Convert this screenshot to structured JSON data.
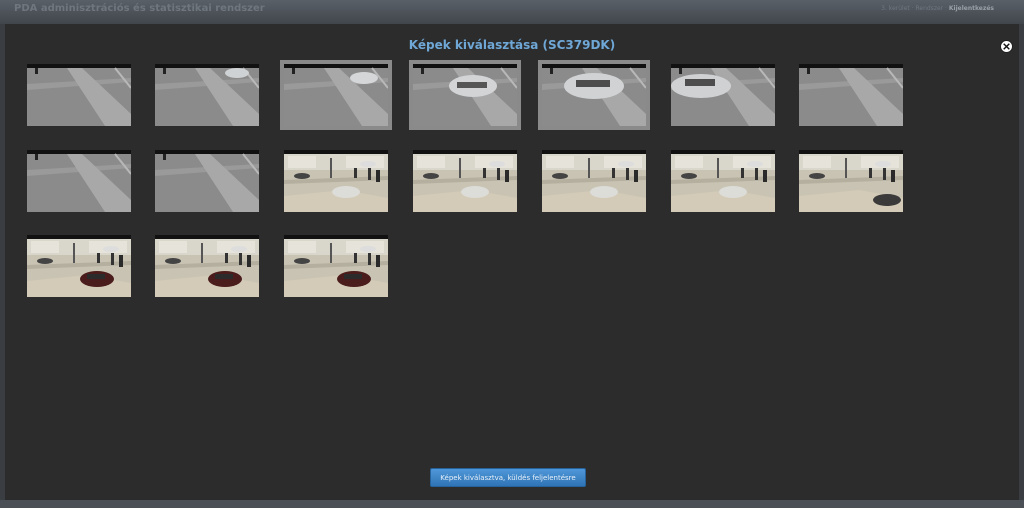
{
  "header": {
    "app_title": "PDA adminisztrációs és statisztikai rendszer",
    "nav_district": "3. kerület",
    "nav_system": "Rendszer",
    "nav_logout": "Kijelentkezés"
  },
  "modal": {
    "title": "Képek kiválasztása (SC379DK)",
    "submit_label": "Képek kiválasztva, küldés feljelentésre",
    "close_icon": "close-icon"
  },
  "thumbnails": [
    {
      "scene": "road",
      "car": "none",
      "selected": false
    },
    {
      "scene": "road",
      "car": "silver-far",
      "selected": false
    },
    {
      "scene": "road",
      "car": "silver-small",
      "selected": true
    },
    {
      "scene": "road",
      "car": "silver-mid",
      "selected": true
    },
    {
      "scene": "road",
      "car": "silver-big",
      "selected": true
    },
    {
      "scene": "road",
      "car": "silver-left",
      "selected": false
    },
    {
      "scene": "road",
      "car": "none",
      "selected": false
    },
    {
      "scene": "road",
      "car": "none",
      "selected": false
    },
    {
      "scene": "road",
      "car": "none",
      "selected": false
    },
    {
      "scene": "plaza",
      "car": "silver",
      "selected": false
    },
    {
      "scene": "plaza",
      "car": "silver",
      "selected": false
    },
    {
      "scene": "plaza",
      "car": "silver",
      "selected": false
    },
    {
      "scene": "plaza",
      "car": "silver",
      "selected": false
    },
    {
      "scene": "plaza",
      "car": "dark",
      "selected": false
    },
    {
      "scene": "plaza",
      "car": "red",
      "selected": false
    },
    {
      "scene": "plaza",
      "car": "red",
      "selected": false
    },
    {
      "scene": "plaza",
      "car": "red",
      "selected": false
    }
  ]
}
